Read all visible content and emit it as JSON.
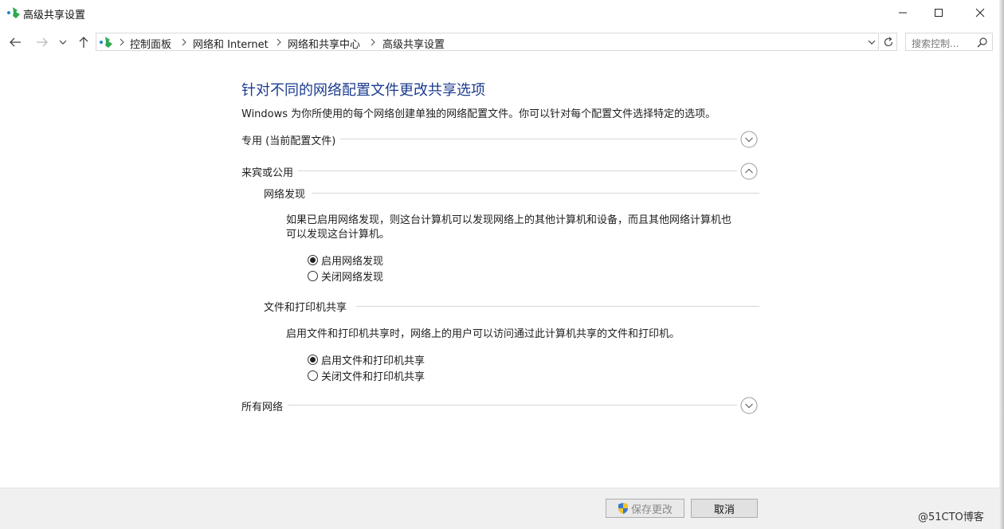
{
  "window": {
    "title": "高级共享设置",
    "icon": "network-sharing-icon"
  },
  "address": {
    "breadcrumbs": [
      "控制面板",
      "网络和 Internet",
      "网络和共享中心",
      "高级共享设置"
    ],
    "search_placeholder": "搜索控制..."
  },
  "main": {
    "title": "针对不同的网络配置文件更改共享选项",
    "description": "Windows 为你所使用的每个网络创建单独的网络配置文件。你可以针对每个配置文件选择特定的选项。",
    "sections": {
      "private": {
        "label": "专用 (当前配置文件)",
        "state": "collapsed"
      },
      "guest_public": {
        "label": "来宾或公用",
        "state": "expanded"
      },
      "all_networks": {
        "label": "所有网络",
        "state": "collapsed"
      }
    },
    "network_discovery": {
      "heading": "网络发现",
      "desc_line1": "如果已启用网络发现，则这台计算机可以发现网络上的其他计算机和设备，而且其他网络计算机也",
      "desc_line2": "可以发现这台计算机。",
      "option_on": "启用网络发现",
      "option_off": "关闭网络发现",
      "selected": "on"
    },
    "file_printer_sharing": {
      "heading": "文件和打印机共享",
      "desc": "启用文件和打印机共享时，网络上的用户可以访问通过此计算机共享的文件和打印机。",
      "option_on": "启用文件和打印机共享",
      "option_off": "关闭文件和打印机共享",
      "selected": "on"
    }
  },
  "footer": {
    "save_label": "保存更改",
    "save_enabled": false,
    "cancel_label": "取消"
  },
  "watermark": "@51CTO博客",
  "colors": {
    "title_blue": "#1b3b8f",
    "footer_bg": "#f0f0f0",
    "divider": "#d6d6d6"
  }
}
